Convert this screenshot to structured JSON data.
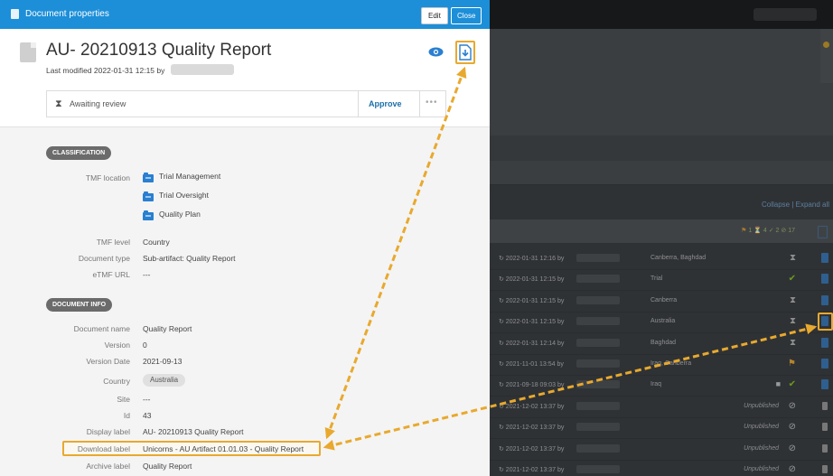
{
  "panel": {
    "title": "Document properties",
    "edit_label": "Edit",
    "close_label": "Close"
  },
  "document": {
    "title": "AU- 20210913 Quality Report",
    "last_modified": "Last modified 2022-01-31 12:15 by"
  },
  "review": {
    "status": "Awaiting review",
    "approve_label": "Approve",
    "more_label": "•••"
  },
  "classification": {
    "badge": "CLASSIFICATION",
    "tmf_location_label": "TMF location",
    "tmf_locations": [
      "Trial Management",
      "Trial Oversight",
      "Quality Plan"
    ],
    "tmf_level_label": "TMF level",
    "tmf_level": "Country",
    "document_type_label": "Document type",
    "document_type": "Sub-artifact: Quality Report",
    "etmf_url_label": "eTMF URL",
    "etmf_url": "---"
  },
  "document_info": {
    "badge": "DOCUMENT INFO",
    "document_name_label": "Document name",
    "document_name": "Quality Report",
    "version_label": "Version",
    "version": "0",
    "version_date_label": "Version Date",
    "version_date": "2021-09-13",
    "country_label": "Country",
    "country": "Australia",
    "site_label": "Site",
    "site": "---",
    "id_label": "Id",
    "id": "43",
    "display_label_label": "Display label",
    "display_label": "AU- 20210913 Quality Report",
    "download_label_label": "Download label",
    "download_label": "Unicorns - AU Artifact 01.01.03 - Quality Report",
    "archive_label_label": "Archive label",
    "archive_label": "Quality Report"
  },
  "background": {
    "collapse_expand": "Collapse | Expand all",
    "summary_stats": "1  ⏳ 4  ✓ 2  ⊘ 17",
    "summary_flag": "⚑",
    "rows": [
      {
        "ts": "↻ 2022-01-31 12:16 by",
        "loc": "Canberra, Baghdad",
        "status": "⧗",
        "status_class": "hg"
      },
      {
        "ts": "↻ 2022-01-31 12:15 by",
        "loc": "Trial",
        "status": "✔",
        "status_class": "ck"
      },
      {
        "ts": "↻ 2022-01-31 12:15 by",
        "loc": "Canberra",
        "status": "⧗",
        "status_class": "hg"
      },
      {
        "ts": "↻ 2022-01-31 12:15 by",
        "loc": "Australia",
        "status": "⧗",
        "status_class": "hg"
      },
      {
        "ts": "↻ 2022-01-31 12:14 by",
        "loc": "Baghdad",
        "status": "⧗",
        "status_class": "hg"
      },
      {
        "ts": "↻ 2021-11-01 13:54 by",
        "loc": "Iraq, Canberra",
        "status": "⚑",
        "status_class": "fl"
      },
      {
        "ts": "↻ 2021-09-18 09:03 by",
        "loc": "Iraq",
        "status": "✔",
        "status_class": "ck"
      },
      {
        "ts": "↻ 2021-12-02 13:37 by",
        "unpub": "Unpublished",
        "status": "⊘",
        "status_class": "nb"
      },
      {
        "ts": "↻ 2021-12-02 13:37 by",
        "unpub": "Unpublished",
        "status": "⊘",
        "status_class": "nb"
      },
      {
        "ts": "↻ 2021-12-02 13:37 by",
        "unpub": "Unpublished",
        "status": "⊘",
        "status_class": "nb"
      },
      {
        "ts": "↻ 2021-12-02 13:37 by",
        "unpub": "Unpublished",
        "status": "⊘",
        "status_class": "nb"
      }
    ]
  },
  "colors": {
    "titlebar": "#1d8fd8",
    "highlight": "#e8a92e",
    "approve": "#1b6fa8",
    "folder": "#2a7fd0"
  }
}
